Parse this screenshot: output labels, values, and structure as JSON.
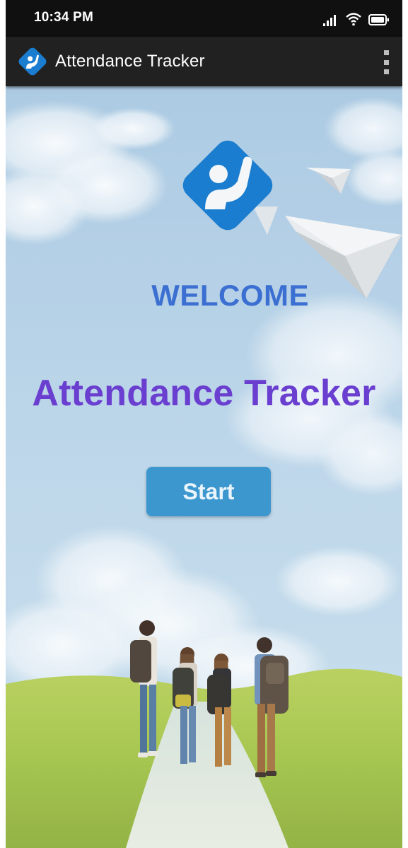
{
  "status_bar": {
    "time": "10:34 PM",
    "icons": [
      "signal-icon",
      "wifi-icon",
      "battery-icon"
    ]
  },
  "app_bar": {
    "title": "Attendance Tracker",
    "logo_icon": "raised-hand-person-icon",
    "menu_icon": "overflow-menu-icon"
  },
  "main": {
    "welcome": "WELCOME",
    "title": "Attendance Tracker",
    "start_label": "Start"
  },
  "colors": {
    "welcome": "#3b6fd1",
    "title": "#6a3fd0",
    "start_button": "#3c97cf",
    "logo_blue": "#1b7dcf",
    "sky": "#b9d6ea",
    "grass": "#a9c84f"
  }
}
